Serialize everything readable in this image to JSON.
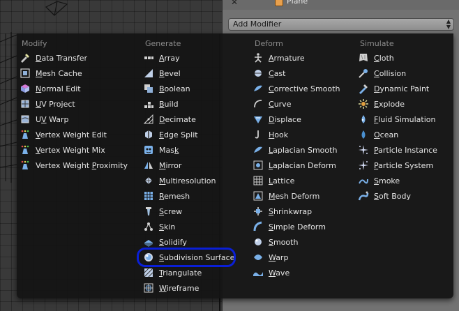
{
  "properties": {
    "object_name": "Plane",
    "add_modifier_label": "Add Modifier"
  },
  "menu": {
    "columns": [
      {
        "heading": "Modify",
        "items": [
          {
            "label": "Data Transfer",
            "icon": "data-transfer-icon"
          },
          {
            "label": "Mesh Cache",
            "icon": "mesh-cache-icon"
          },
          {
            "label": "Normal Edit",
            "icon": "normal-edit-icon"
          },
          {
            "label": "UV Project",
            "icon": "uv-project-icon"
          },
          {
            "label": "UV Warp",
            "icon": "uv-warp-icon"
          },
          {
            "label": "Vertex Weight Edit",
            "icon": "vertex-weight-edit-icon"
          },
          {
            "label": "Vertex Weight Mix",
            "icon": "vertex-weight-mix-icon"
          },
          {
            "label": "Vertex Weight Proximity",
            "icon": "vertex-weight-proximity-icon"
          }
        ]
      },
      {
        "heading": "Generate",
        "items": [
          {
            "label": "Array",
            "icon": "array-icon"
          },
          {
            "label": "Bevel",
            "icon": "bevel-icon"
          },
          {
            "label": "Boolean",
            "icon": "boolean-icon"
          },
          {
            "label": "Build",
            "icon": "build-icon"
          },
          {
            "label": "Decimate",
            "icon": "decimate-icon"
          },
          {
            "label": "Edge Split",
            "icon": "edge-split-icon"
          },
          {
            "label": "Mask",
            "icon": "mask-icon"
          },
          {
            "label": "Mirror",
            "icon": "mirror-icon"
          },
          {
            "label": "Multiresolution",
            "icon": "multiresolution-icon"
          },
          {
            "label": "Remesh",
            "icon": "remesh-icon"
          },
          {
            "label": "Screw",
            "icon": "screw-icon"
          },
          {
            "label": "Skin",
            "icon": "skin-icon"
          },
          {
            "label": "Solidify",
            "icon": "solidify-icon"
          },
          {
            "label": "Subdivision Surface",
            "icon": "subdivision-surface-icon"
          },
          {
            "label": "Triangulate",
            "icon": "triangulate-icon"
          },
          {
            "label": "Wireframe",
            "icon": "wireframe-icon"
          }
        ]
      },
      {
        "heading": "Deform",
        "items": [
          {
            "label": "Armature",
            "icon": "armature-icon"
          },
          {
            "label": "Cast",
            "icon": "cast-icon"
          },
          {
            "label": "Corrective Smooth",
            "icon": "corrective-smooth-icon"
          },
          {
            "label": "Curve",
            "icon": "curve-icon"
          },
          {
            "label": "Displace",
            "icon": "displace-icon"
          },
          {
            "label": "Hook",
            "icon": "hook-icon"
          },
          {
            "label": "Laplacian Smooth",
            "icon": "laplacian-smooth-icon"
          },
          {
            "label": "Laplacian Deform",
            "icon": "laplacian-deform-icon"
          },
          {
            "label": "Lattice",
            "icon": "lattice-icon"
          },
          {
            "label": "Mesh Deform",
            "icon": "mesh-deform-icon"
          },
          {
            "label": "Shrinkwrap",
            "icon": "shrinkwrap-icon"
          },
          {
            "label": "Simple Deform",
            "icon": "simple-deform-icon"
          },
          {
            "label": "Smooth",
            "icon": "smooth-icon"
          },
          {
            "label": "Warp",
            "icon": "warp-icon"
          },
          {
            "label": "Wave",
            "icon": "wave-icon"
          }
        ]
      },
      {
        "heading": "Simulate",
        "items": [
          {
            "label": "Cloth",
            "icon": "cloth-icon"
          },
          {
            "label": "Collision",
            "icon": "collision-icon"
          },
          {
            "label": "Dynamic Paint",
            "icon": "dynamic-paint-icon"
          },
          {
            "label": "Explode",
            "icon": "explode-icon"
          },
          {
            "label": "Fluid Simulation",
            "icon": "fluid-simulation-icon"
          },
          {
            "label": "Ocean",
            "icon": "ocean-icon"
          },
          {
            "label": "Particle Instance",
            "icon": "particle-instance-icon"
          },
          {
            "label": "Particle System",
            "icon": "particle-system-icon"
          },
          {
            "label": "Smoke",
            "icon": "smoke-icon"
          },
          {
            "label": "Soft Body",
            "icon": "soft-body-icon"
          }
        ]
      }
    ]
  },
  "colors": {
    "menu_bg": "#141414",
    "text": "#e6e6e6",
    "heading": "#8c8c8c",
    "highlight_ring": "#0a1fd6"
  }
}
